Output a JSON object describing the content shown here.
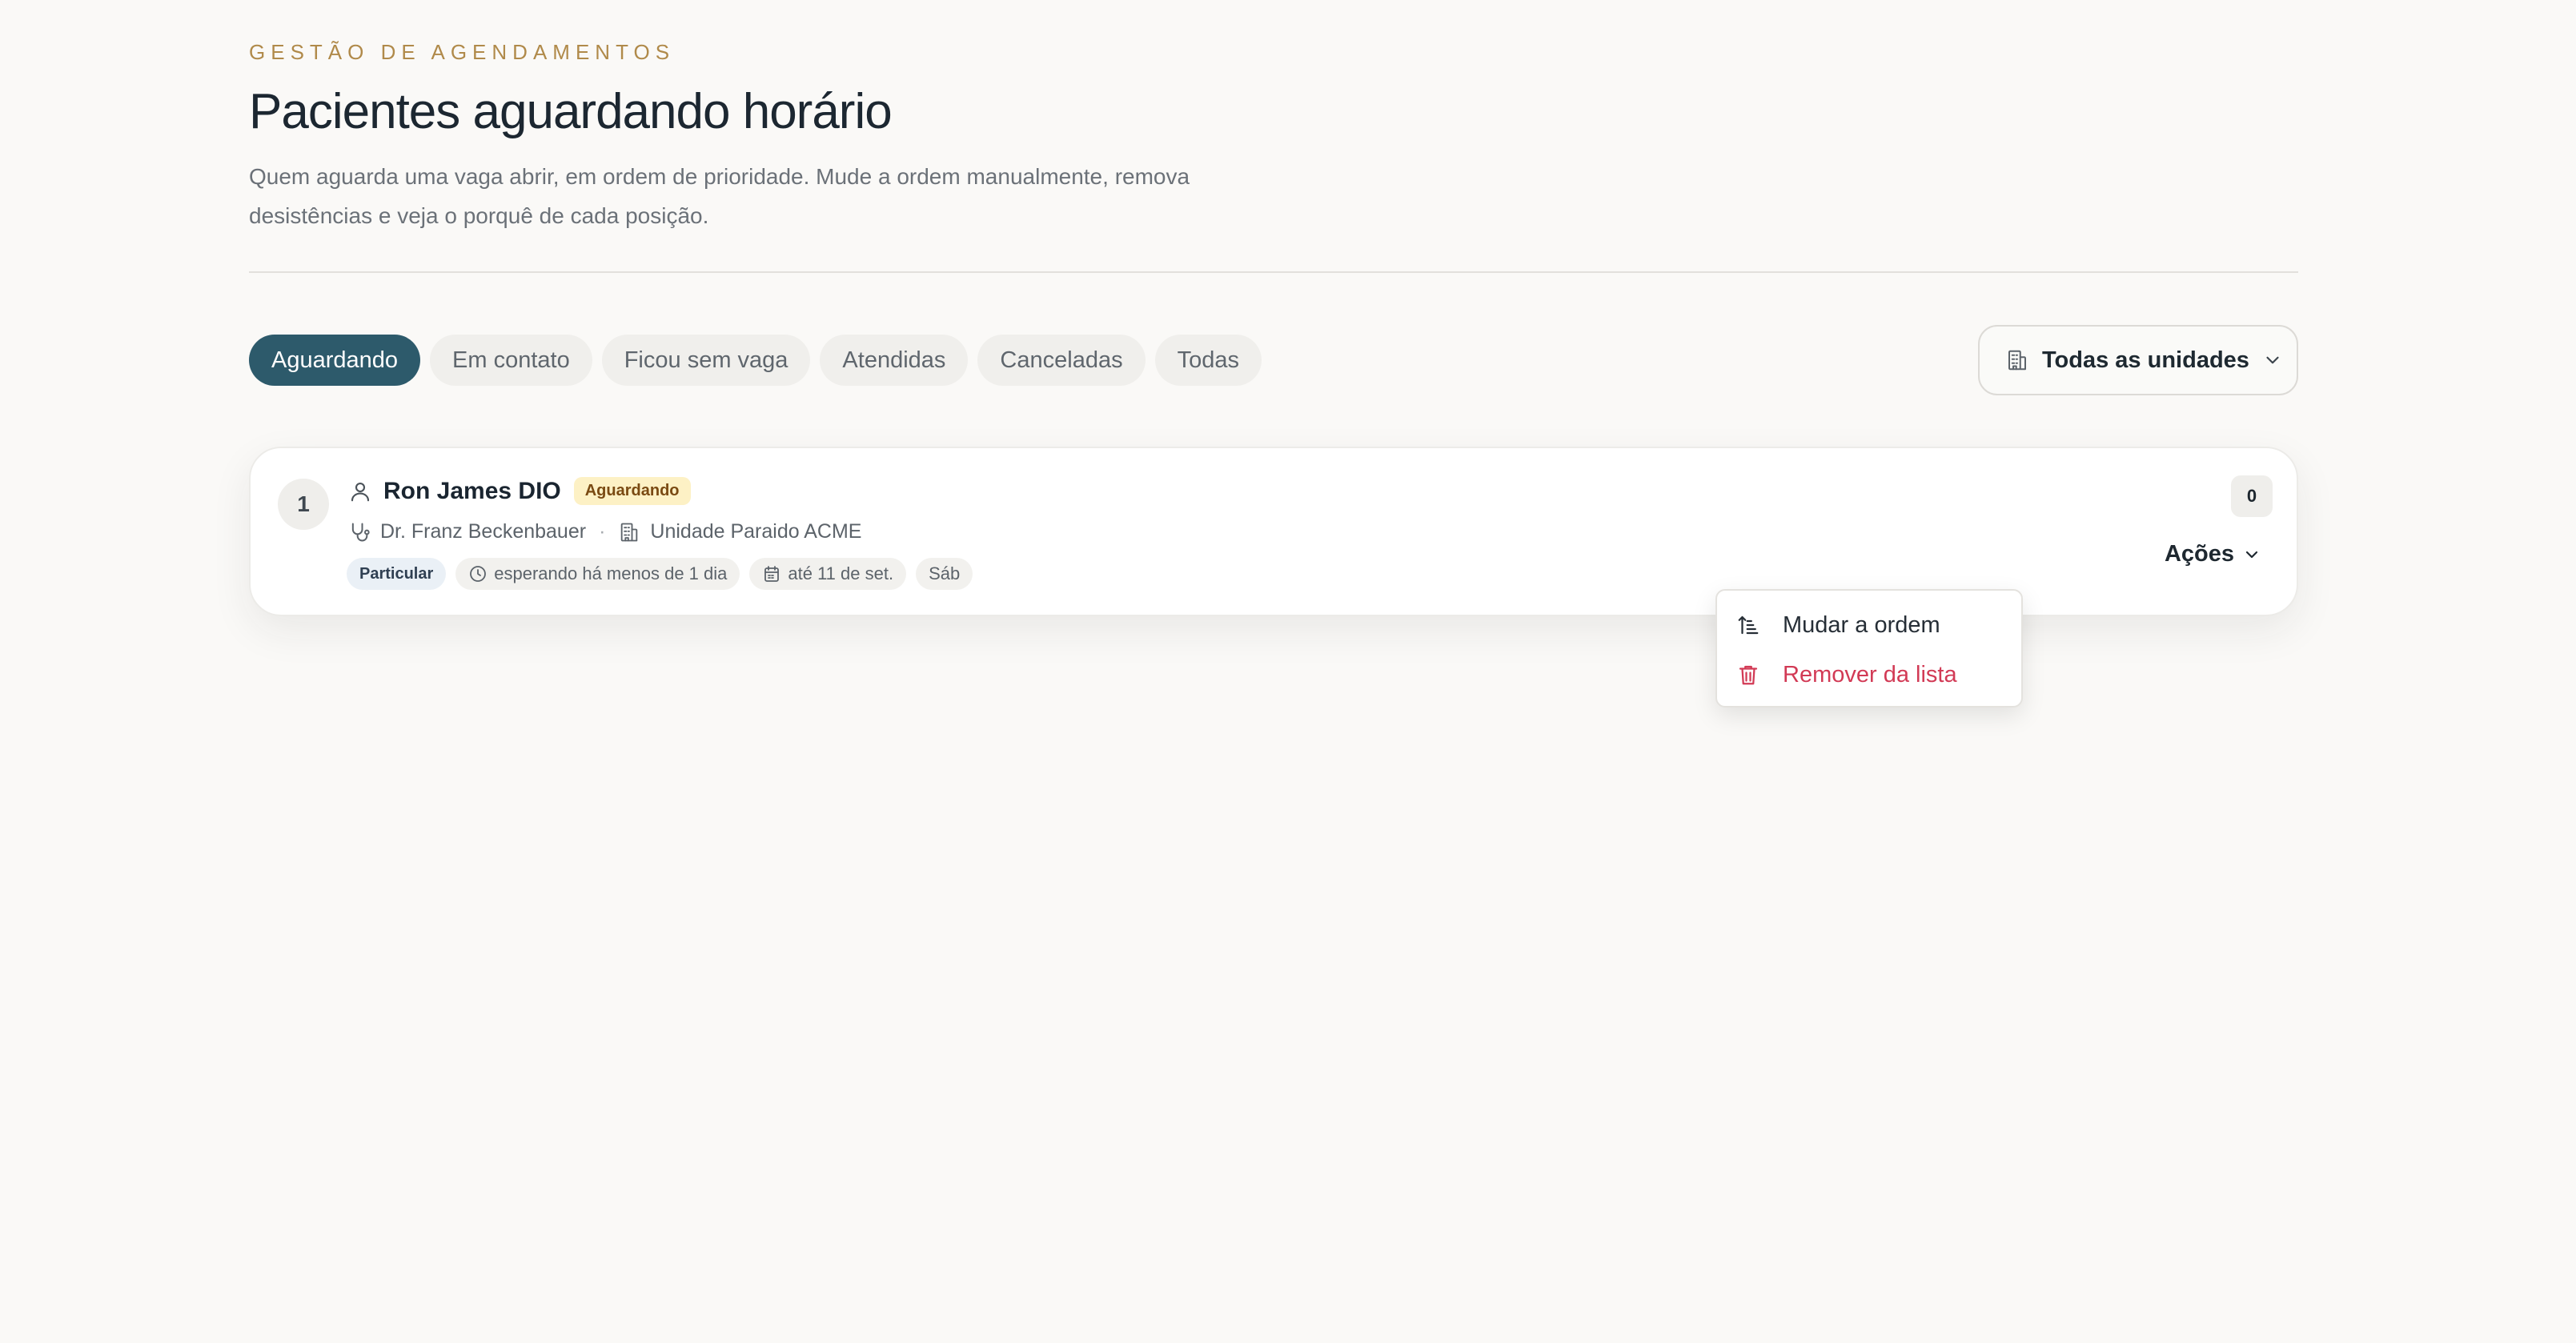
{
  "header": {
    "eyebrow": "GESTÃO DE AGENDAMENTOS",
    "title": "Pacientes aguardando horário",
    "subtitle": "Quem aguarda uma vaga abrir, em ordem de prioridade. Mude a ordem manualmente, remova desistências e veja o porquê de cada posição."
  },
  "tabs": [
    {
      "label": "Aguardando",
      "active": true
    },
    {
      "label": "Em contato"
    },
    {
      "label": "Ficou sem vaga"
    },
    {
      "label": "Atendidas"
    },
    {
      "label": "Canceladas"
    },
    {
      "label": "Todas"
    }
  ],
  "unit_filter": {
    "label": "Todas as unidades",
    "icon": "building-icon"
  },
  "patients": [
    {
      "rank": "1",
      "name": "Ron James DIO",
      "status": "Aguardando",
      "doctor": "Dr. Franz Beckenbauer",
      "unit": "Unidade Paraido ACME",
      "type": "Particular",
      "waiting": "esperando há menos de 1 dia",
      "until": "até 11 de set.",
      "day": "Sáb",
      "count": "0",
      "actions_label": "Ações"
    }
  ],
  "actions_menu": {
    "items": [
      {
        "label": "Mudar a ordem",
        "icon": "sort-ascending-icon"
      },
      {
        "label": "Remover da lista",
        "icon": "trash-icon",
        "danger": true
      }
    ]
  },
  "colors": {
    "accent": "#2d5a6b",
    "eyebrow": "#b08a4a",
    "status_badge_bg": "#fdf1c5",
    "danger": "#d23a55"
  }
}
